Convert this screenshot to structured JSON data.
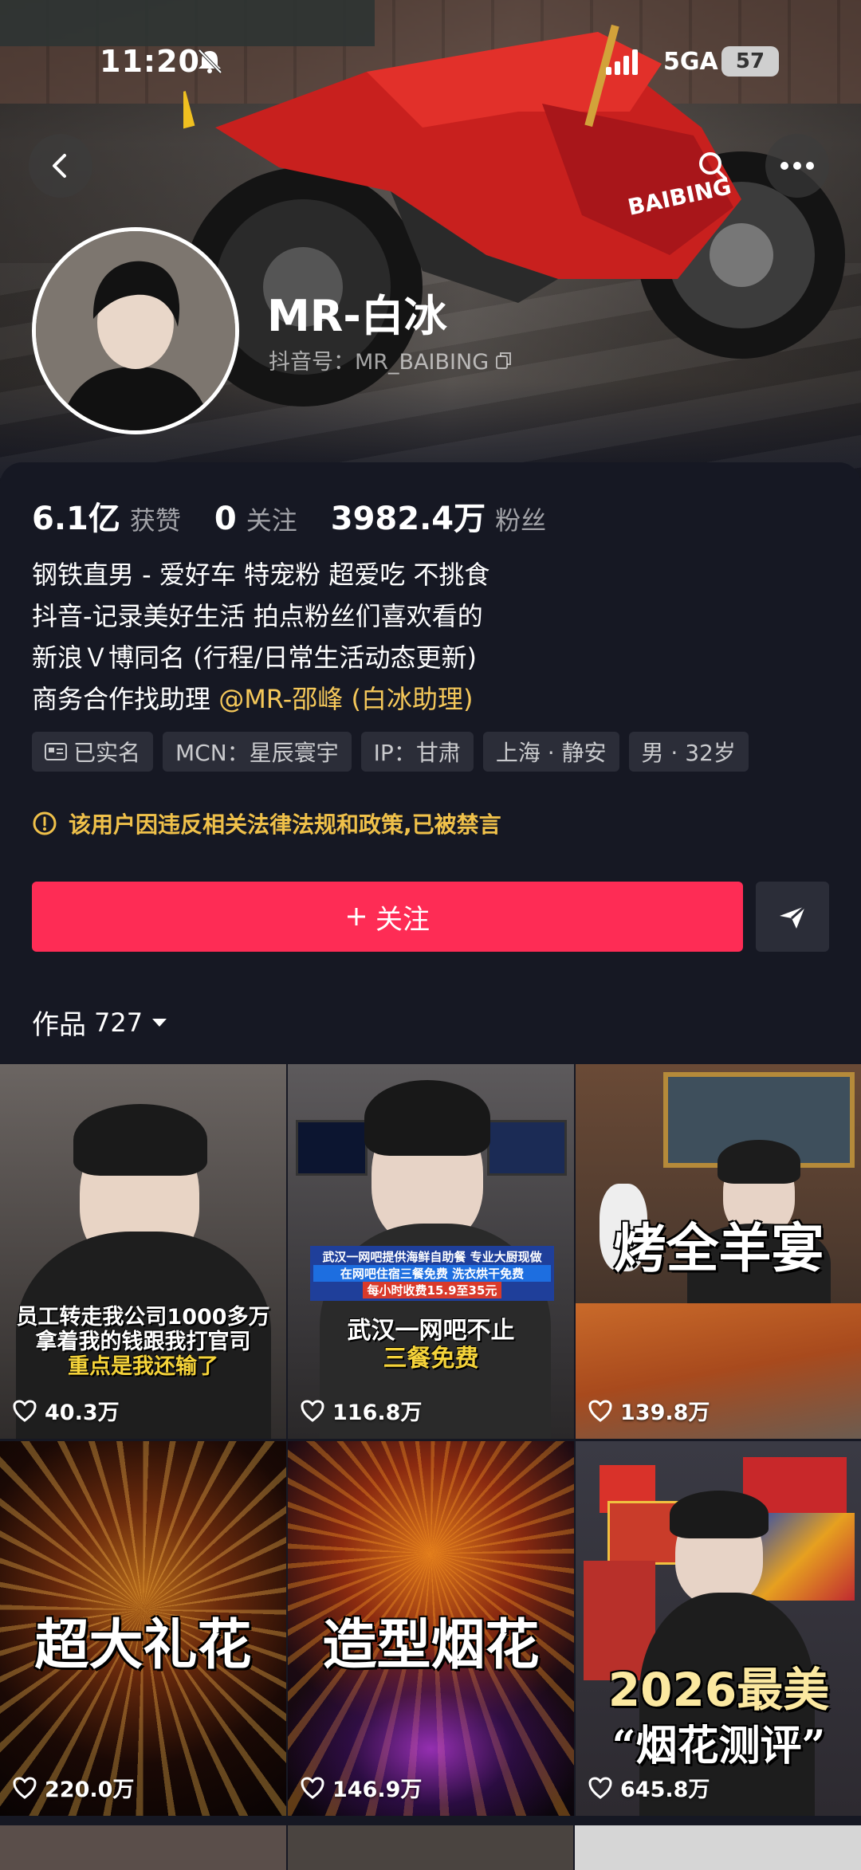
{
  "status_bar": {
    "time": "11:20",
    "network": "5GA",
    "battery": "57"
  },
  "profile": {
    "name": "MR-白冰",
    "douyin_id": "抖音号：MR_BAIBING",
    "stats": [
      {
        "value": "6.1亿",
        "label": "获赞"
      },
      {
        "value": "0",
        "label": "关注"
      },
      {
        "value": "3982.4万",
        "label": "粉丝"
      }
    ],
    "bio_lines": [
      "钢铁直男 - 爱好车 特宠粉 超爱吃 不挑食",
      "抖音-记录美好生活 拍点粉丝们喜欢看的",
      "新浪Ｖ博同名 (行程/日常生活动态更新)"
    ],
    "bio_last_prefix": "商务合作找助理 ",
    "bio_mention": "@MR-邵峰 (白冰助理)",
    "tags": [
      "已实名",
      "MCN：星辰寰宇",
      "IP：甘肃",
      "上海 · 静安",
      "男 · 32岁"
    ],
    "notice": "该用户因违反相关法律法规和政策,已被禁言",
    "follow_label": "关注",
    "works_label": "作品",
    "works_count": "727"
  },
  "videos": [
    {
      "likes": "40.3万",
      "caption_lines": [
        "员工转走我公司1000多万",
        "拿着我的钱跟我打官司",
        "重点是我还输了"
      ]
    },
    {
      "likes": "116.8万",
      "banner_lines": [
        "武汉一网吧提供海鲜自助餐 专业大厨现做",
        "在网吧住宿三餐免费 洗衣烘干免费",
        "每小时收费15.9至35元"
      ],
      "caption_lines": [
        "武汉一网吧不止",
        "三餐免费"
      ]
    },
    {
      "likes": "139.8万",
      "caption": "烤全羊宴"
    },
    {
      "likes": "220.0万",
      "caption": "超大礼花"
    },
    {
      "likes": "146.9万",
      "caption": "造型烟花"
    },
    {
      "likes": "645.8万",
      "caption_top": "2026最美",
      "caption_bottom": "“烟花测评”"
    }
  ],
  "colors": {
    "accent": "#fe2c55",
    "notice": "#f0c14a",
    "mention": "#f5c85a",
    "background": "#161823"
  }
}
